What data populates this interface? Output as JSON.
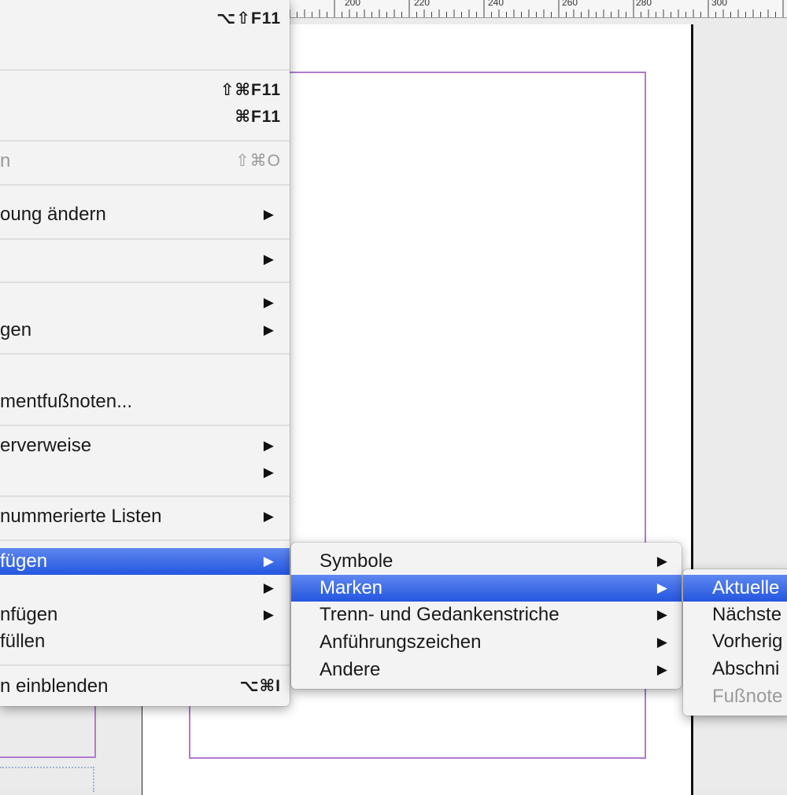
{
  "ruler": {
    "ticks": [
      "200",
      "220",
      "240",
      "260",
      "280",
      "300"
    ]
  },
  "main_menu": {
    "items": [
      {
        "label": "",
        "shortcut": "⌥⇧F11",
        "arrow": ""
      },
      {
        "label": "",
        "shortcut": "⇧⌘F11",
        "arrow": ""
      },
      {
        "label": "",
        "shortcut": "⌘F11",
        "arrow": ""
      },
      {
        "label": "n",
        "shortcut": "⇧⌘O",
        "arrow": ""
      },
      {
        "label": "oung ändern",
        "shortcut": "",
        "arrow": "▶"
      },
      {
        "label": "",
        "shortcut": "",
        "arrow": "▶"
      },
      {
        "label": "",
        "shortcut": "",
        "arrow": "▶"
      },
      {
        "label": "gen",
        "shortcut": "",
        "arrow": "▶"
      },
      {
        "label": "mentfußnoten...",
        "shortcut": "",
        "arrow": ""
      },
      {
        "label": "erverweise",
        "shortcut": "",
        "arrow": "▶"
      },
      {
        "label": "",
        "shortcut": "",
        "arrow": "▶"
      },
      {
        "label": "nummerierte Listen",
        "shortcut": "",
        "arrow": "▶"
      },
      {
        "label": "fügen",
        "shortcut": "",
        "arrow": "▶"
      },
      {
        "label": "",
        "shortcut": "",
        "arrow": "▶"
      },
      {
        "label": "nfügen",
        "shortcut": "",
        "arrow": "▶"
      },
      {
        "label": "füllen",
        "shortcut": "",
        "arrow": ""
      },
      {
        "label": "n einblenden",
        "shortcut": "⌥⌘I",
        "arrow": ""
      }
    ]
  },
  "sub_menu": {
    "items": [
      {
        "label": "Symbole",
        "arrow": "▶"
      },
      {
        "label": "Marken",
        "arrow": "▶"
      },
      {
        "label": "Trenn- und Gedankenstriche",
        "arrow": "▶"
      },
      {
        "label": "Anführungszeichen",
        "arrow": "▶"
      },
      {
        "label": "Andere",
        "arrow": "▶"
      }
    ]
  },
  "sub_sub_menu": {
    "items": [
      {
        "label": "Aktuelle"
      },
      {
        "label": "Nächste"
      },
      {
        "label": "Vorherig"
      },
      {
        "label": "Abschni"
      },
      {
        "label": "Fußnote"
      }
    ]
  },
  "colors": {
    "selection": "#2f5fe4",
    "margin_guide": "#b07ad1",
    "menu_bg": "#f3f3f3",
    "disabled_text": "#9a9a9a"
  }
}
